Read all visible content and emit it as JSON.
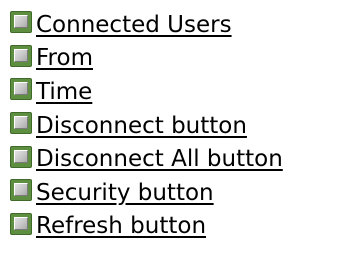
{
  "topics": [
    {
      "label": "Connected Users",
      "icon": "help-topic-icon"
    },
    {
      "label": "From",
      "icon": "help-topic-icon"
    },
    {
      "label": "Time",
      "icon": "help-topic-icon"
    },
    {
      "label": "Disconnect button",
      "icon": "help-topic-icon"
    },
    {
      "label": "Disconnect All button",
      "icon": "help-topic-icon"
    },
    {
      "label": "Security button",
      "icon": "help-topic-icon"
    },
    {
      "label": "Refresh button",
      "icon": "help-topic-icon"
    }
  ]
}
